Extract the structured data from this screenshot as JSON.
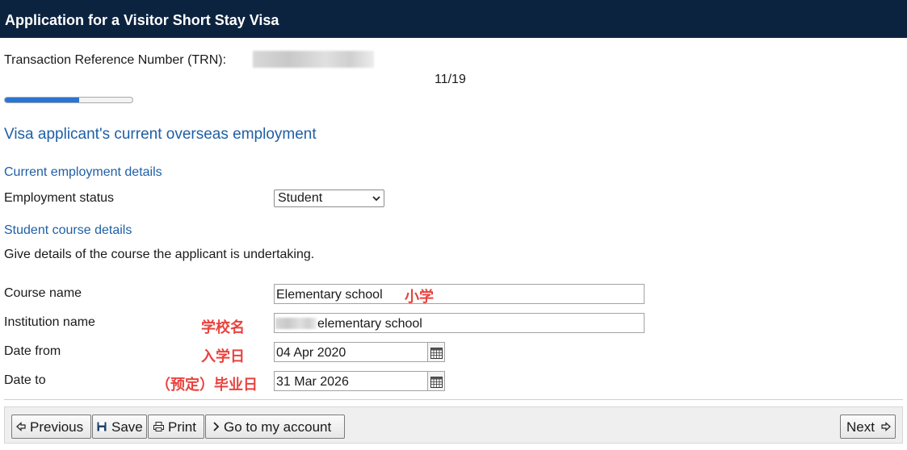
{
  "header": {
    "title": "Application for a Visitor Short Stay Visa"
  },
  "trn": {
    "label": "Transaction Reference Number (TRN):"
  },
  "progress": {
    "page_indicator": "11/19",
    "fraction": 0.58
  },
  "section": {
    "title": "Visa applicant's current overseas employment"
  },
  "employment": {
    "heading": "Current employment details",
    "status_label": "Employment status",
    "status_value": "Student"
  },
  "course": {
    "heading": "Student course details",
    "instructions": "Give details of the course the applicant is undertaking.",
    "course_name_label": "Course name",
    "course_name_value": "Elementary school",
    "course_name_note": "小学",
    "institution_label": "Institution name",
    "institution_note": "学校名",
    "institution_value": "elementary school",
    "date_from_label": "Date from",
    "date_from_note": "入学日",
    "date_from_value": "04 Apr 2020",
    "date_to_label": "Date to",
    "date_to_note": "（预定）毕业日",
    "date_to_value": "31 Mar 2026"
  },
  "footer": {
    "previous": "Previous",
    "save": "Save",
    "print": "Print",
    "account": "Go to my account",
    "next": "Next"
  },
  "colors": {
    "header_bg": "#0c2340",
    "accent": "#1f5fa6",
    "annotation": "#e8433e",
    "progress": "#2a74d6"
  },
  "icons": [
    "calendar-icon",
    "save-icon",
    "print-icon",
    "chevron-right-icon",
    "arrow-left-icon",
    "arrow-right-icon",
    "chevron-down-icon"
  ]
}
